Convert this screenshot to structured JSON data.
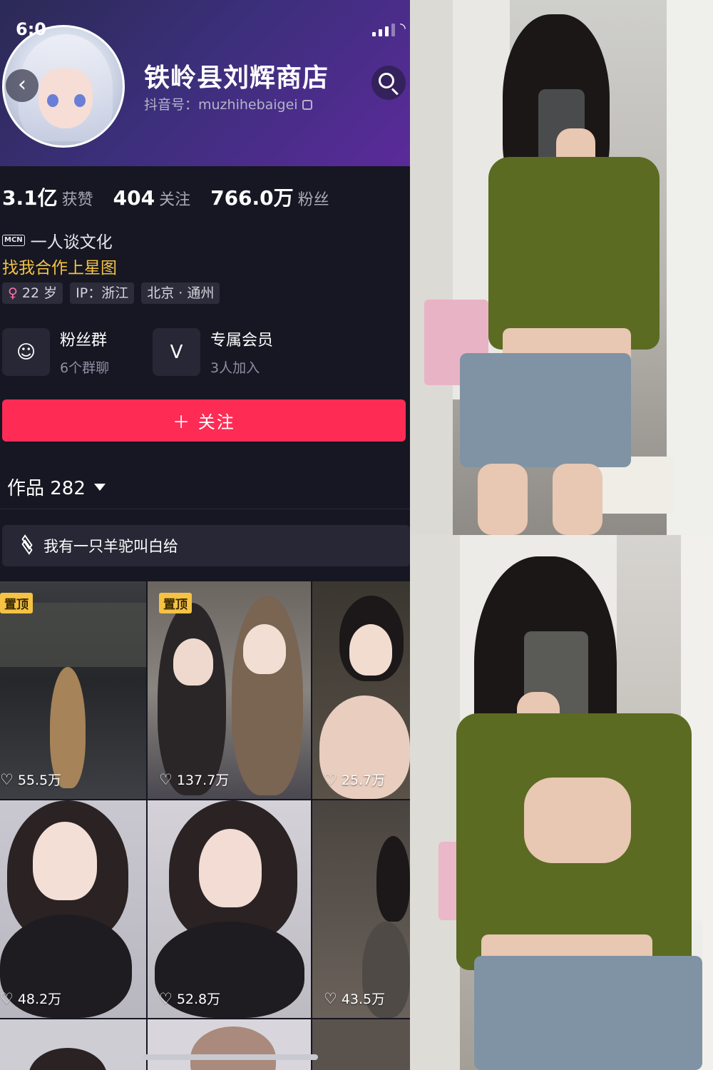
{
  "status_bar": {
    "time": "6:0"
  },
  "profile": {
    "name": "铁岭县刘辉商店",
    "douyin_id": "抖音号：muzhihebaigei",
    "stats": [
      {
        "value": "3.1亿",
        "label": "获赞"
      },
      {
        "value": "404",
        "label": "关注"
      },
      {
        "value": "766.0万",
        "label": "粉丝"
      }
    ],
    "mcn_badge": "MCN",
    "mcn_text": "一人谈文化",
    "star_link": "找我合作上星图",
    "tags": {
      "age": "22 岁",
      "ip": "IP：浙江",
      "location": "北京 · 通州"
    },
    "features": [
      {
        "title": "粉丝群",
        "sub": "6个群聊",
        "icon": "fan-group-icon"
      },
      {
        "title": "专属会员",
        "sub": "3人加入",
        "icon": "v-member-icon"
      }
    ],
    "follow_label": "＋ 关注",
    "works_label": "作品 282",
    "collection_label": "我有一只羊驼叫白给"
  },
  "videos": [
    {
      "pinned": true,
      "pin_label": "置顶",
      "likes": "55.5万"
    },
    {
      "pinned": true,
      "pin_label": "置顶",
      "likes": "137.7万"
    },
    {
      "pinned": false,
      "likes": "25.7万"
    },
    {
      "pinned": false,
      "likes": "48.2万"
    },
    {
      "pinned": false,
      "likes": "52.8万"
    },
    {
      "pinned": false,
      "likes": "43.5万"
    }
  ],
  "colors": {
    "accent_follow": "#fe2c55",
    "pin_badge": "#f5c243",
    "star_link": "#f5c243",
    "background": "#161722"
  }
}
